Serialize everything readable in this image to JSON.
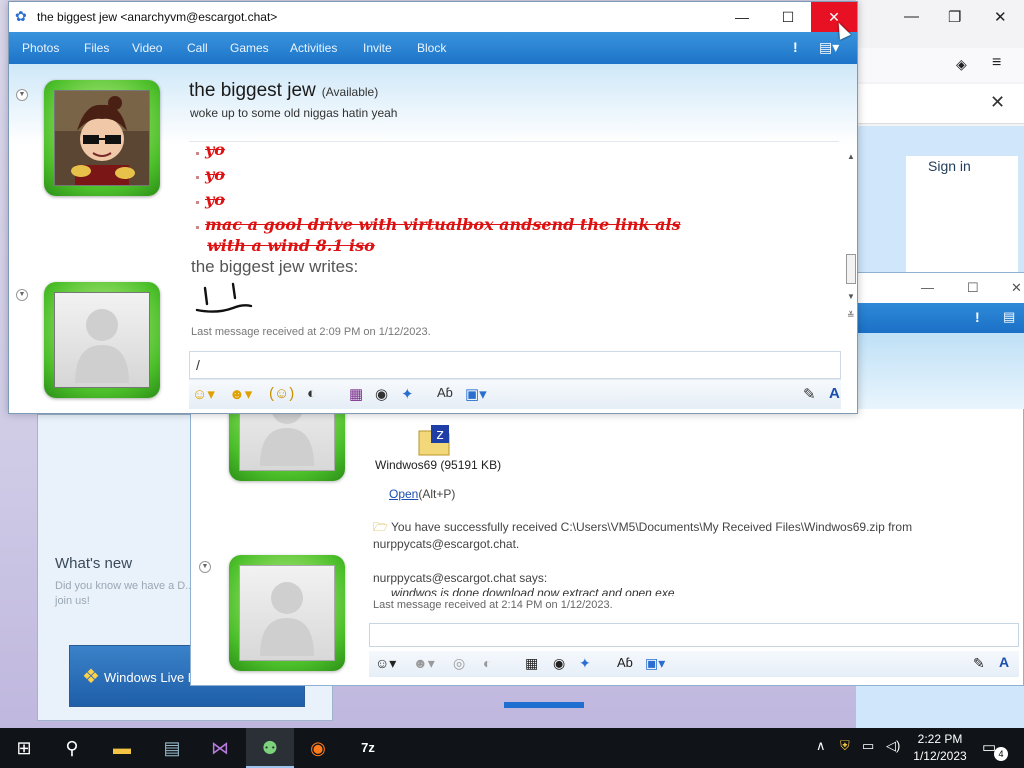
{
  "browser": {
    "signin_label": "Sign in",
    "controls": {
      "minimize": "—",
      "maximize": "❐",
      "close": "✕"
    }
  },
  "main_window": {
    "whats_new_title": "What's new",
    "whats_new_text": "Did you know we have a D... to join us!",
    "logo_text": "Windows Live M"
  },
  "conv2": {
    "file_name": "Windwos69 (95191 KB)",
    "open_label": "Open",
    "open_shortcut": "(Alt+P)",
    "received_text": "You have successfully received C:\\Users\\VM5\\Documents\\My Received Files\\Windwos69.zip from nurppycats@escargot.chat.",
    "says_line": "nurppycats@escargot.chat says:",
    "says_message": "windwos is done download now extract and open exe",
    "last_message": "Last message received at 2:14 PM on 1/12/2023."
  },
  "conv1": {
    "window_title": "the biggest jew <anarchyvm@escargot.chat>",
    "menu": [
      "Photos",
      "Files",
      "Video",
      "Call",
      "Games",
      "Activities",
      "Invite",
      "Block"
    ],
    "contact_name": "the biggest jew",
    "contact_status": "(Available)",
    "personal_message": "woke up to some old niggas hatin yeah",
    "messages": [
      "yo",
      "yo",
      "yo",
      "mac a gool drive with virtualbox andsend the link als",
      "with a wind 8.1 iso"
    ],
    "writes_label": "the biggest jew writes:",
    "last_message": "Last message received at 2:09 PM on 1/12/2023.",
    "input_value": "/"
  },
  "taskbar": {
    "items": [
      "start-button",
      "search-button",
      "file-explorer",
      "mmc",
      "visual-studio",
      "messenger",
      "firefox",
      "7zip"
    ],
    "clock_time": "2:22 PM",
    "clock_date": "1/12/2023",
    "notification_count": "4"
  },
  "colors": {
    "accent_blue": "#1d74c8",
    "avatar_green": "#4cbf2a",
    "close_red": "#e81123",
    "message_red": "#d11111"
  }
}
